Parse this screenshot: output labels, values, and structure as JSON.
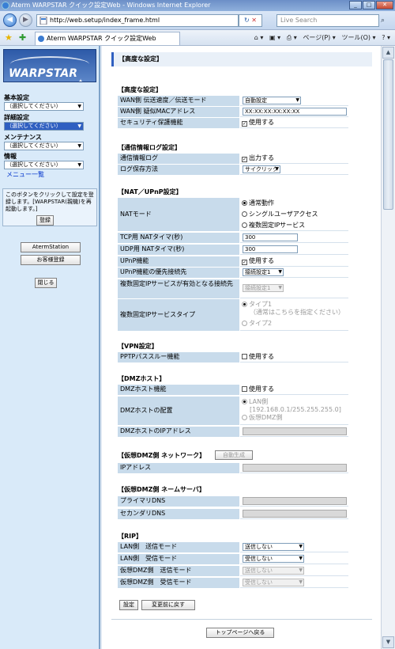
{
  "window": {
    "title": "Aterm WARPSTAR クイック設定Web - Windows Internet Explorer"
  },
  "address": {
    "url": "http://web.setup/index_frame.html",
    "search_placeholder": "Live Search"
  },
  "tab": {
    "title": "Aterm WARPSTAR クイック設定Web"
  },
  "commandbar": {
    "page": "ページ(P)",
    "tools": "ツール(O)"
  },
  "sidebar": {
    "logo": "WARPSTAR",
    "basic_label": "基本設定",
    "basic_value": "（選択してください）",
    "detail_label": "詳細設定",
    "detail_value": "（選択してください）",
    "maint_label": "メンテナンス",
    "maint_value": "（選択してください）",
    "info_label": "情報",
    "info_value": "（選択してください）",
    "menu_link": "メニュー一覧",
    "info_text": "このボタンをクリックして設定を登録します。[WARPSTAR(親機)を再起動します。]",
    "register_button": "登録",
    "aterm_button": "AtermStation",
    "customer_button": "お客様登録",
    "close_button": "閉じる"
  },
  "page": {
    "title": "【高度な設定】",
    "sec_advanced": "【高度な設定】",
    "wan_speed_label": "WAN側 伝送速度／伝送モード",
    "wan_speed_value": "自動設定",
    "wan_mac_label": "WAN側 疑似MACアドレス",
    "wan_mac_value": "XX:XX:XX:XX:XX:XX",
    "security_label": "セキュリティ保護機能",
    "security_value": "使用する",
    "sec_log": "【通信情報ログ設定】",
    "log_label": "通信情報ログ",
    "log_value": "出力する",
    "log_method_label": "ログ保存方法",
    "log_method_value": "サイクリック",
    "sec_nat": "【NAT／UPnP設定】",
    "nat_mode_label": "NATモード",
    "nat_opt1": "通常動作",
    "nat_opt2": "シングルユーザアクセス",
    "nat_opt3": "複数固定IPサービス",
    "tcp_label": "TCP用 NATタイマ(秒)",
    "tcp_value": "300",
    "udp_label": "UDP用 NATタイマ(秒)",
    "udp_value": "300",
    "upnp_label": "UPnP機能",
    "upnp_value": "使用する",
    "upnp_prio_label": "UPnP機能の優先接続先",
    "upnp_prio_value": "接続設定1",
    "multi_ip_dest_label": "複数固定IPサービスが有効となる接続先",
    "multi_ip_dest_value": "接続設定1",
    "multi_ip_type_label": "複数固定IPサービスタイプ",
    "type1_line1": "タイプ1",
    "type1_line2": "（通常はこちらを指定ください）",
    "type2": "タイプ2",
    "sec_vpn": "【VPN設定】",
    "pptp_label": "PPTPパススルー機能",
    "pptp_value": "使用する",
    "sec_dmz": "【DMZホスト】",
    "dmz_func_label": "DMZホスト機能",
    "dmz_func_value": "使用する",
    "dmz_place_label": "DMZホストの配置",
    "dmz_lan_line1": "LAN側",
    "dmz_lan_line2": "[192.168.0.1/255.255.255.0]",
    "dmz_virtual": "仮想DMZ側",
    "dmz_ip_label": "DMZホストのIPアドレス",
    "sec_vdmz_net": "【仮想DMZ側 ネットワーク】",
    "auto_gen_button": "自動生成",
    "ip_label": "IPアドレス",
    "sec_vdmz_dns": "【仮想DMZ側 ネームサーバ】",
    "primary_dns_label": "プライマリDNS",
    "secondary_dns_label": "セカンダリDNS",
    "sec_rip": "【RIP】",
    "lan_send_label": "LAN側　送信モード",
    "lan_send_value": "送信しない",
    "lan_recv_label": "LAN側　受信モード",
    "lan_recv_value": "受信しない",
    "vdmz_send_label": "仮想DMZ側　送信モード",
    "vdmz_send_value": "送信しない",
    "vdmz_recv_label": "仮想DMZ側　受信モード",
    "vdmz_recv_value": "受信しない",
    "set_button": "設定",
    "revert_button": "変更前に戻す",
    "top_button": "トップページへ戻る"
  },
  "colors": {
    "accent": "#2f5fc1",
    "label_bg": "#c8dbeb",
    "sidebar_bg": "#d9eaf9"
  }
}
